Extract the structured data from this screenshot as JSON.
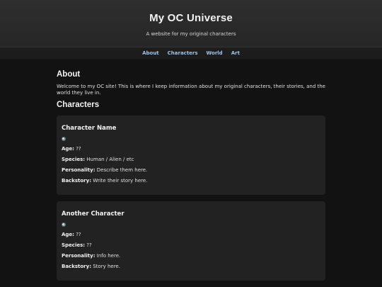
{
  "site": {
    "title": "My OC Universe",
    "subtitle": "A website for my original characters"
  },
  "nav": {
    "items": [
      "About",
      "Characters",
      "World",
      "Art"
    ]
  },
  "about": {
    "heading": "About",
    "text": "Welcome to my OC site! This is where I keep information about my original characters, their stories, and the world they live in."
  },
  "characters": {
    "heading": "Characters",
    "cards": [
      {
        "name": "Character Name",
        "image_icon": "broken-image-icon",
        "age_label": "Age:",
        "age": "??",
        "species_label": "Species:",
        "species": "Human / Alien / etc",
        "personality_label": "Personality:",
        "personality": "Describe them here.",
        "backstory_label": "Backstory:",
        "backstory": "Write their story here."
      },
      {
        "name": "Another Character",
        "image_icon": "broken-image-icon",
        "age_label": "Age:",
        "age": "??",
        "species_label": "Species:",
        "species": "??",
        "personality_label": "Personality:",
        "personality": "Info here.",
        "backstory_label": "Backstory:",
        "backstory": "Story here."
      }
    ]
  },
  "colors": {
    "background": "#121212",
    "header": "#2a2a2a",
    "card": "#222222",
    "nav_link": "#9cc4ea"
  }
}
